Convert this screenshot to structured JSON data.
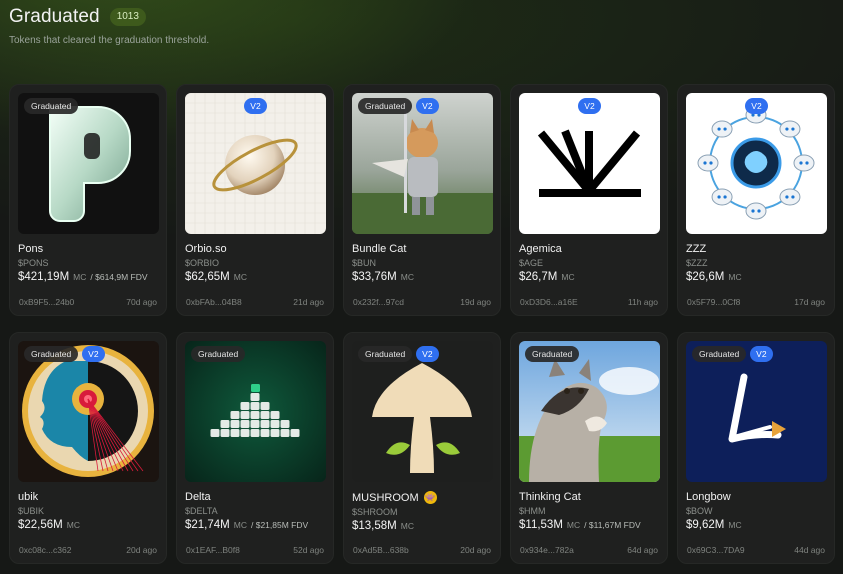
{
  "header": {
    "title": "Graduated",
    "count": "1013",
    "subtitle": "Tokens that cleared the graduation threshold."
  },
  "labels": {
    "graduated": "Graduated",
    "v2": "V2",
    "mc": "MC"
  },
  "tokens": [
    {
      "name": "Pons",
      "ticker": "$PONS",
      "mc": "$421,19M",
      "fdv": "/ $614,9M FDV",
      "address": "0xB9F5...24b0",
      "age": "70d ago",
      "graduated": true,
      "v2": false,
      "image": "glossy-p-logo"
    },
    {
      "name": "Orbio.so",
      "ticker": "$ORBIO",
      "mc": "$62,65M",
      "fdv": "",
      "address": "0xbFAb...04B8",
      "age": "21d ago",
      "graduated": false,
      "v2": true,
      "image": "orb-with-ring"
    },
    {
      "name": "Bundle Cat",
      "ticker": "$BUN",
      "mc": "$33,76M",
      "fdv": "",
      "address": "0x232f...97cd",
      "age": "19d ago",
      "graduated": true,
      "v2": true,
      "image": "knight-cat"
    },
    {
      "name": "Agemica",
      "ticker": "$AGE",
      "mc": "$26,7M",
      "fdv": "",
      "address": "0xD3D6...a16E",
      "age": "11h ago",
      "graduated": false,
      "v2": true,
      "image": "sunrise-rays-logo"
    },
    {
      "name": "ZZZ",
      "ticker": "$ZZZ",
      "mc": "$26,6M",
      "fdv": "",
      "address": "0x5F79...0Cf8",
      "age": "17d ago",
      "graduated": false,
      "v2": true,
      "image": "robots-brain-circle"
    },
    {
      "name": "ubik",
      "ticker": "$UBIK",
      "mc": "$22,56M",
      "fdv": "",
      "address": "0xc08c...c362",
      "age": "20d ago",
      "graduated": true,
      "v2": true,
      "image": "head-profile-eye"
    },
    {
      "name": "Delta",
      "ticker": "$DELTA",
      "mc": "$21,74M",
      "fdv": "/ $21,85M FDV",
      "address": "0x1EAF...B0f8",
      "age": "52d ago",
      "graduated": true,
      "v2": false,
      "image": "cube-pyramid"
    },
    {
      "name": "MUSHROOM",
      "ticker": "$SHROOM",
      "mc": "$13,58M",
      "fdv": "",
      "address": "0xAd5B...638b",
      "age": "20d ago",
      "graduated": true,
      "v2": true,
      "image": "mushroom",
      "emoji": "👾"
    },
    {
      "name": "Thinking Cat",
      "ticker": "$HMM",
      "mc": "$11,53M",
      "fdv": "/ $11,67M FDV",
      "address": "0x934e...782a",
      "age": "64d ago",
      "graduated": true,
      "v2": false,
      "image": "thinking-cat"
    },
    {
      "name": "Longbow",
      "ticker": "$BOW",
      "mc": "$9,62M",
      "fdv": "",
      "address": "0x69C3...7DA9",
      "age": "44d ago",
      "graduated": true,
      "v2": true,
      "image": "bow-arrow-logo"
    }
  ]
}
